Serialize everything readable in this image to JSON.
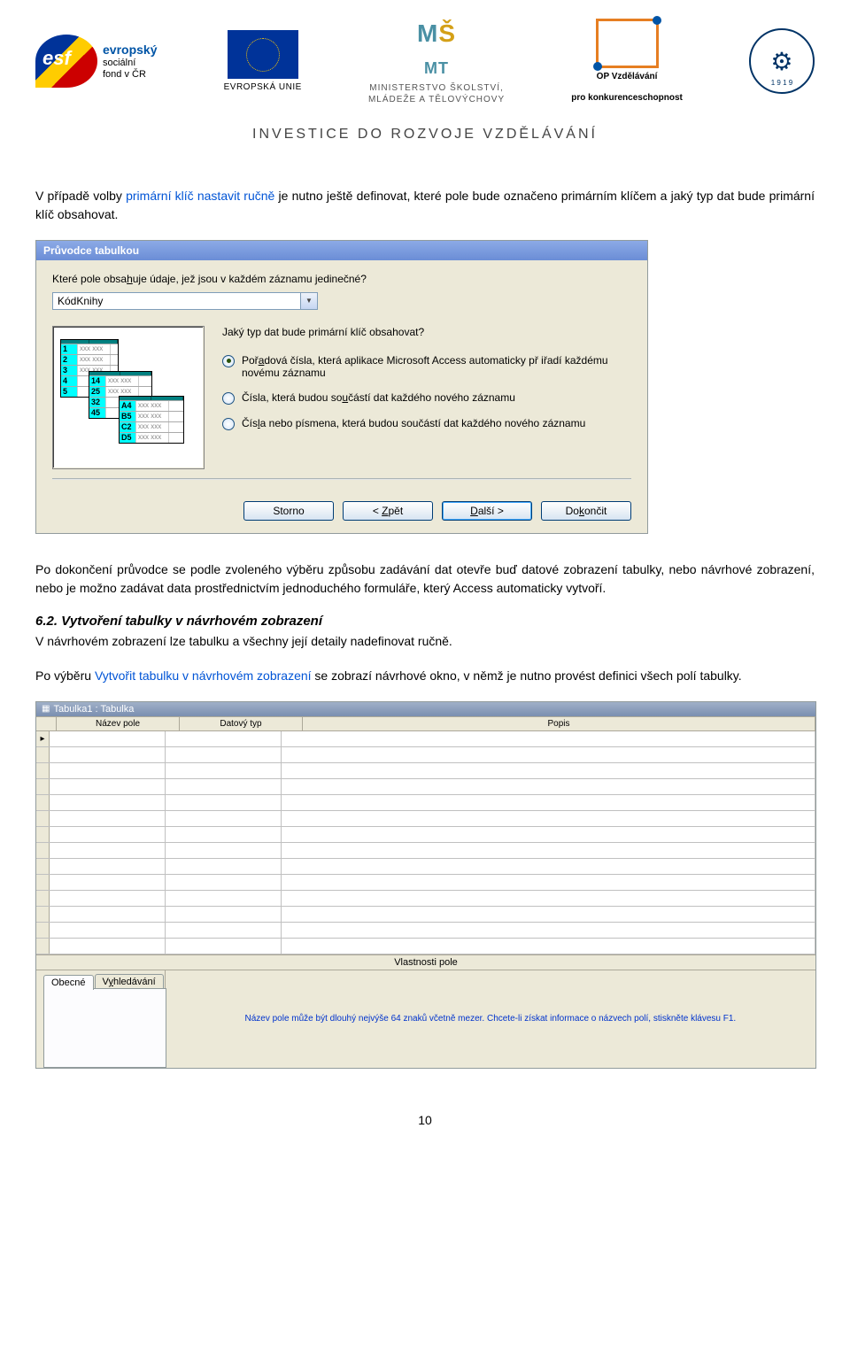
{
  "header": {
    "esf_bold": "evropský",
    "esf_l2": "sociální",
    "esf_l3": "fond v ČR",
    "eu_label": "EVROPSKÁ UNIE",
    "msmt_l1": "MINISTERSTVO ŠKOLSTVÍ,",
    "msmt_l2": "MLÁDEŽE A TĚLOVÝCHOVY",
    "op_l1": "OP Vzdělávání",
    "op_l2": "pro konkurenceschopnost",
    "seal_year": "1 9 1 9",
    "investice": "INVESTICE DO ROZVOJE VZDĚLÁVÁNÍ"
  },
  "para1_pre": "V případě volby ",
  "para1_blue": "primární klíč nastavit ručně",
  "para1_post": " je nutno ještě definovat, které pole bude označeno primárním klíčem a jaký typ dat bude primární klíč obsahovat.",
  "wizard": {
    "title": "Průvodce tabulkou",
    "q1_pre": "Které pole obsa",
    "q1_u": "h",
    "q1_post": "uje údaje, jež jsou v každém záznamu jedinečné?",
    "combo_value": "KódKnihy",
    "q2": "Jaký typ dat bude primární klíč obsahovat?",
    "r1_pre": "Poř",
    "r1_u": "a",
    "r1_post": "dová čísla, která aplikace Microsoft Access automaticky př iřadí každému novému záznamu",
    "r2_pre": "Čísla, která budou so",
    "r2_u": "u",
    "r2_post": "částí dat každého nového záznamu",
    "r3_pre": "Čís",
    "r3_u": "l",
    "r3_post": "a nebo písmena, která budou součástí dat každého nového záznamu",
    "btn_cancel": "Storno",
    "btn_back_pre": "< ",
    "btn_back_u": "Z",
    "btn_back_post": "pět",
    "btn_next_u": "D",
    "btn_next_post": "alší >",
    "btn_finish_pre": "Do",
    "btn_finish_u": "k",
    "btn_finish_post": "ončit"
  },
  "para2": "Po dokončení průvodce se podle zvoleného výběru způsobu zadávání dat otevře buď datové zobrazení tabulky, nebo návrhové zobrazení, nebo je možno zadávat data prostřednictvím jednoduchého formuláře, který Access automaticky vytvoří.",
  "section_heading": "6.2. Vytvoření tabulky v návrhovém zobrazení",
  "para3": "V návrhovém zobrazení lze tabulku a všechny její detaily nadefinovat ručně.",
  "para4_pre": "Po výběru ",
  "para4_blue": "Vytvořit tabulku v návrhovém zobrazení",
  "para4_post": " se zobrazí návrhové okno, v němž je nutno provést definici všech polí tabulky.",
  "design": {
    "title": "Tabulka1 : Tabulka",
    "col_name": "Název pole",
    "col_type": "Datový typ",
    "col_desc": "Popis",
    "props_title": "Vlastnosti pole",
    "tab1": "Obecné",
    "tab2_pre": "V",
    "tab2_u": "y",
    "tab2_post": "hledávání",
    "hint": "Název pole může být dlouhý nejvýše 64 znaků včetně mezer. Chcete-li získat informace o názvech polí, stiskněte klávesu F1."
  },
  "page_number": "10"
}
